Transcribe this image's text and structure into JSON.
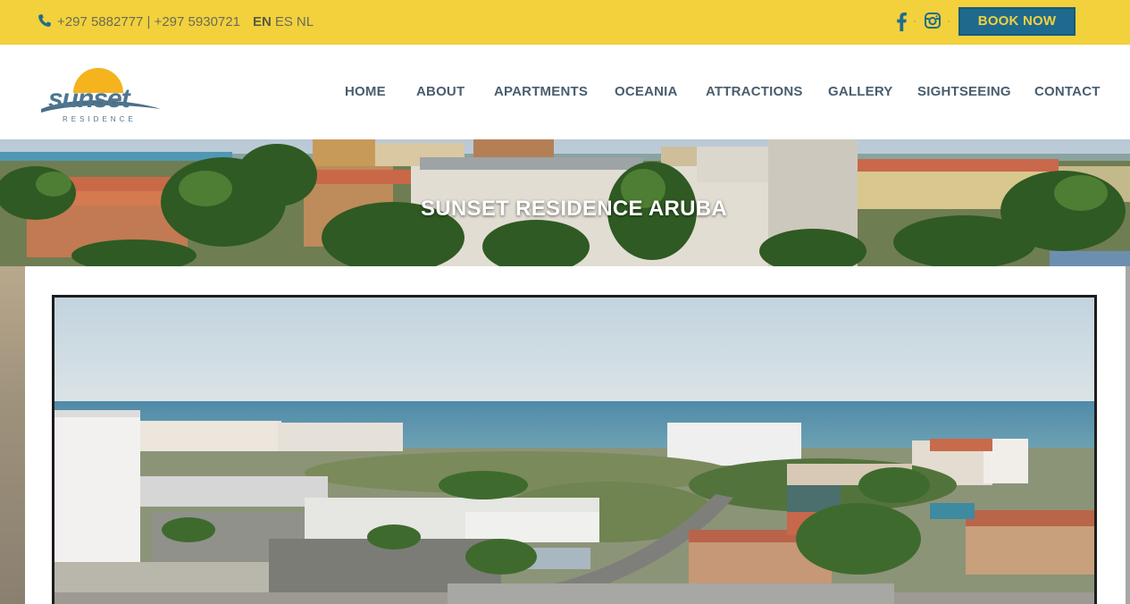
{
  "topbar": {
    "phone": "+297 5882777 | +297 5930721",
    "languages": [
      "EN",
      "ES",
      "NL"
    ],
    "active_language": "EN",
    "book_button": "BOOK NOW",
    "colors": {
      "bar": "#f2d13d",
      "button": "#1e6a8f",
      "button_text": "#f2d13d"
    }
  },
  "logo": {
    "word": "sunset",
    "sub": "RESIDENCE"
  },
  "nav": {
    "home": "HOME",
    "about": "ABOUT",
    "apartments": "APARTMENTS",
    "oceania": "OCEANIA",
    "attractions": "ATTRACTIONS",
    "gallery": "GALLERY",
    "sightseeing": "SIGHTSEEING",
    "contact": "CONTACT"
  },
  "hero": {
    "title": "SUNSET RESIDENCE ARUBA"
  }
}
